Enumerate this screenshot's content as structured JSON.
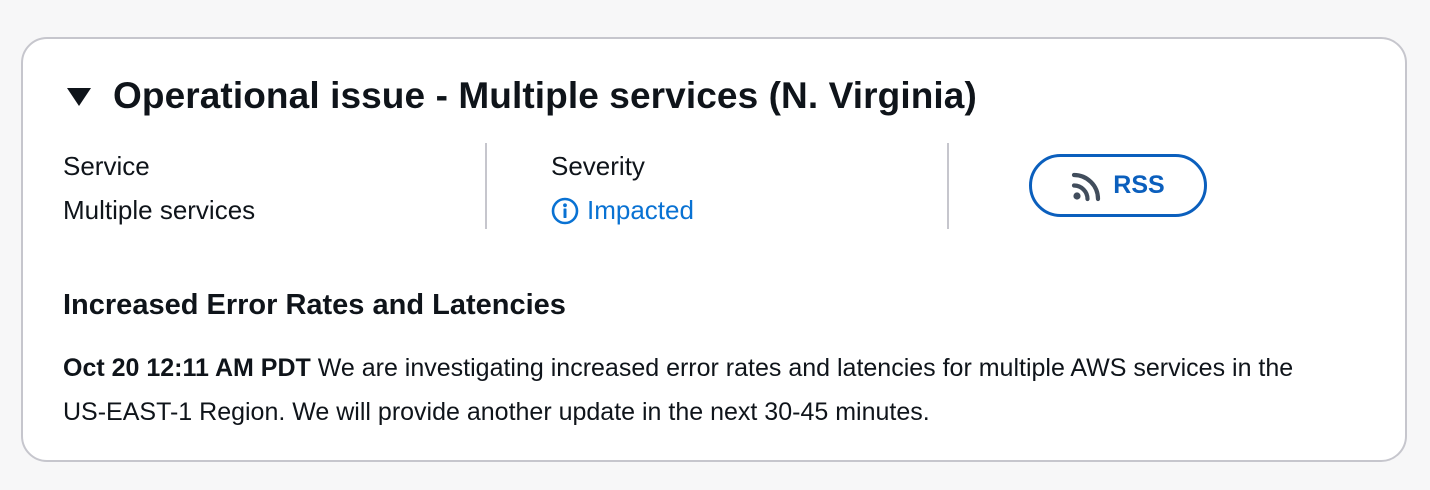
{
  "event": {
    "title": "Operational issue - Multiple services (N. Virginia)",
    "expand_icon": "caret-down-icon",
    "service_label": "Service",
    "service_value": "Multiple services",
    "severity_label": "Severity",
    "severity_value": "Impacted",
    "severity_icon": "info-circle-icon",
    "rss_label": "RSS",
    "rss_icon": "rss-feed-icon"
  },
  "update": {
    "heading": "Increased Error Rates and Latencies",
    "timestamp": "Oct 20 12:11 AM PDT",
    "message": "We are investigating increased error rates and latencies for multiple AWS services in the US-EAST-1 Region. We will provide another update in the next 30-45 minutes."
  },
  "colors": {
    "accent": "#0972d3",
    "button_border": "#0b5fbd",
    "card_border": "#c6c6cd",
    "text": "#0f141a"
  }
}
